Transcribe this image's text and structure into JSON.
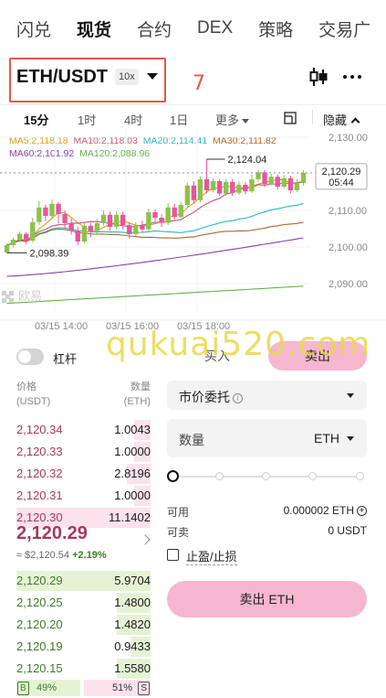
{
  "topnav": {
    "tabs": [
      {
        "label": "闪兑",
        "active": false
      },
      {
        "label": "现货",
        "active": true
      },
      {
        "label": "合约",
        "active": false
      },
      {
        "label": "DEX",
        "active": false
      },
      {
        "label": "策略",
        "active": false
      },
      {
        "label": "交易广",
        "active": false
      }
    ]
  },
  "pair": {
    "name": "ETH/USDT",
    "leverage": "10x",
    "annotation": "7"
  },
  "header_icons": {
    "chart": "candlestick-chart-icon",
    "more": "more-dots-icon"
  },
  "timeframes": {
    "items": [
      "15分",
      "1时",
      "4时",
      "1日",
      "更多"
    ],
    "active": "15分",
    "hide_label": "隐藏",
    "settings_icon": "chart-settings-icon"
  },
  "chart_data": {
    "type": "candlestick",
    "ma": [
      {
        "label": "MA5:",
        "value": "2,118.18",
        "color": "#d4a017"
      },
      {
        "label": "MA10:",
        "value": "2,118.03",
        "color": "#c0587a"
      },
      {
        "label": "MA20:",
        "value": "2,114.41",
        "color": "#2bb5c2"
      },
      {
        "label": "MA30:",
        "value": "2,111.82",
        "color": "#b5652a"
      },
      {
        "label": "MA60:",
        "value": "2,101.92",
        "color": "#8a3fb0"
      },
      {
        "label": "MA120:",
        "value": "2,088.96",
        "color": "#63b34b"
      }
    ],
    "y_ticks": [
      "2,130.00",
      "2,120.00",
      "2,110.00",
      "2,100.00",
      "2,090.00"
    ],
    "y_tick_values": [
      2130,
      2120,
      2110,
      2100,
      2090
    ],
    "x_ticks": [
      "03/15 14:00",
      "03/15 16:00",
      "03/15 18:00"
    ],
    "last_price": "2,120.29",
    "countdown": "05:44",
    "high_label": "2,124.04",
    "low_label": "2,098.39",
    "logo_text": "欧易",
    "up_color": "#8bc34a",
    "down_color": "#e8559b",
    "candles": [
      [
        2098.5,
        2100.5,
        2098.4,
        2101.0
      ],
      [
        2100.5,
        2102.0,
        2099.8,
        2102.6
      ],
      [
        2102.0,
        2103.6,
        2101.3,
        2104.2
      ],
      [
        2103.6,
        2101.7,
        2100.8,
        2104.0
      ],
      [
        2101.7,
        2106.8,
        2101.2,
        2108.0
      ],
      [
        2106.8,
        2110.8,
        2106.0,
        2112.5
      ],
      [
        2110.8,
        2108.5,
        2107.0,
        2111.6
      ],
      [
        2108.5,
        2111.8,
        2107.8,
        2113.0
      ],
      [
        2111.8,
        2109.0,
        2106.5,
        2112.4
      ],
      [
        2109.0,
        2106.5,
        2105.0,
        2110.0
      ],
      [
        2106.5,
        2104.5,
        2103.4,
        2107.8
      ],
      [
        2104.5,
        2101.5,
        2100.5,
        2105.6
      ],
      [
        2101.5,
        2105.8,
        2101.0,
        2106.7
      ],
      [
        2105.8,
        2104.3,
        2102.7,
        2106.6
      ],
      [
        2104.3,
        2106.5,
        2103.6,
        2107.5
      ],
      [
        2106.5,
        2108.8,
        2105.8,
        2110.0
      ],
      [
        2108.8,
        2105.5,
        2104.4,
        2109.7
      ],
      [
        2105.5,
        2108.8,
        2104.8,
        2109.8
      ],
      [
        2108.8,
        2106.0,
        2104.8,
        2109.6
      ],
      [
        2106.0,
        2103.5,
        2102.3,
        2106.8
      ],
      [
        2103.5,
        2105.9,
        2102.9,
        2106.8
      ],
      [
        2105.9,
        2104.8,
        2104.0,
        2107.2
      ],
      [
        2104.8,
        2109.5,
        2104.2,
        2110.5
      ],
      [
        2109.5,
        2108.0,
        2107.0,
        2110.3
      ],
      [
        2108.0,
        2106.6,
        2105.5,
        2108.9
      ],
      [
        2106.6,
        2110.8,
        2106.0,
        2112.0
      ],
      [
        2110.8,
        2108.2,
        2107.5,
        2111.8
      ],
      [
        2108.2,
        2111.5,
        2107.8,
        2112.4
      ],
      [
        2111.5,
        2116.8,
        2110.9,
        2117.6
      ],
      [
        2116.8,
        2112.8,
        2111.8,
        2118.0
      ],
      [
        2112.8,
        2118.5,
        2112.2,
        2119.3
      ],
      [
        2118.5,
        2115.5,
        2114.6,
        2124.0
      ],
      [
        2115.5,
        2118.0,
        2114.9,
        2118.8
      ],
      [
        2118.0,
        2114.6,
        2114.0,
        2118.6
      ],
      [
        2114.6,
        2117.8,
        2114.0,
        2118.5
      ],
      [
        2117.8,
        2114.8,
        2114.0,
        2118.6
      ],
      [
        2114.8,
        2117.0,
        2114.2,
        2118.0
      ],
      [
        2117.0,
        2115.2,
        2114.4,
        2117.8
      ],
      [
        2115.2,
        2118.5,
        2114.8,
        2119.8
      ],
      [
        2118.5,
        2120.4,
        2117.9,
        2121.0
      ],
      [
        2120.4,
        2117.2,
        2116.4,
        2121.0
      ],
      [
        2117.2,
        2119.2,
        2116.8,
        2120.0
      ],
      [
        2119.2,
        2116.5,
        2115.7,
        2119.8
      ],
      [
        2116.5,
        2118.8,
        2116.0,
        2119.7
      ],
      [
        2118.8,
        2115.5,
        2114.6,
        2119.5
      ],
      [
        2115.5,
        2117.5,
        2115.0,
        2118.6
      ],
      [
        2117.5,
        2120.3,
        2116.8,
        2121.0
      ]
    ]
  },
  "trade": {
    "leverage_label": "杠杆",
    "buy_label": "买入",
    "sell_label": "卖出",
    "watermark": "qukuai520.com"
  },
  "orderbook": {
    "price_header": "价格",
    "price_unit": "(USDT)",
    "qty_header": "数量",
    "qty_unit": "(ETH)",
    "asks": [
      {
        "price": "2,120.34",
        "qty": "1.0043",
        "depth": 0.12
      },
      {
        "price": "2,120.33",
        "qty": "1.0000",
        "depth": 0.12
      },
      {
        "price": "2,120.32",
        "qty": "2.8196",
        "depth": 0.18
      },
      {
        "price": "2,120.31",
        "qty": "1.0000",
        "depth": 0.12
      },
      {
        "price": "2,120.30",
        "qty": "11.1402",
        "depth": 1.0
      }
    ],
    "mid_price": "2,120.29",
    "mid_usd": "≈ $2,120.54",
    "mid_change": "+2.19%",
    "bids": [
      {
        "price": "2,120.29",
        "qty": "5.9704",
        "depth": 1.0
      },
      {
        "price": "2,120.25",
        "qty": "1.4800",
        "depth": 0.25
      },
      {
        "price": "2,120.20",
        "qty": "1.4820",
        "depth": 0.25
      },
      {
        "price": "2,120.19",
        "qty": "0.9433",
        "depth": 0.15
      },
      {
        "price": "2,120.15",
        "qty": "1.5580",
        "depth": 0.25
      }
    ],
    "ratio_b_label": "B",
    "ratio_b": "49%",
    "ratio_s": "51%",
    "ratio_s_label": "S",
    "ratio_b_fraction": 0.49
  },
  "form": {
    "order_type": "市价委托",
    "qty_label": "数量",
    "qty_unit": "ETH",
    "slider_value": 0,
    "available_label": "可用",
    "available_value": "0.000002 ETH",
    "sellable_label": "可卖",
    "sellable_value": "0 USDT",
    "tpsl_label": "止盈/止损",
    "submit_label": "卖出 ETH"
  }
}
